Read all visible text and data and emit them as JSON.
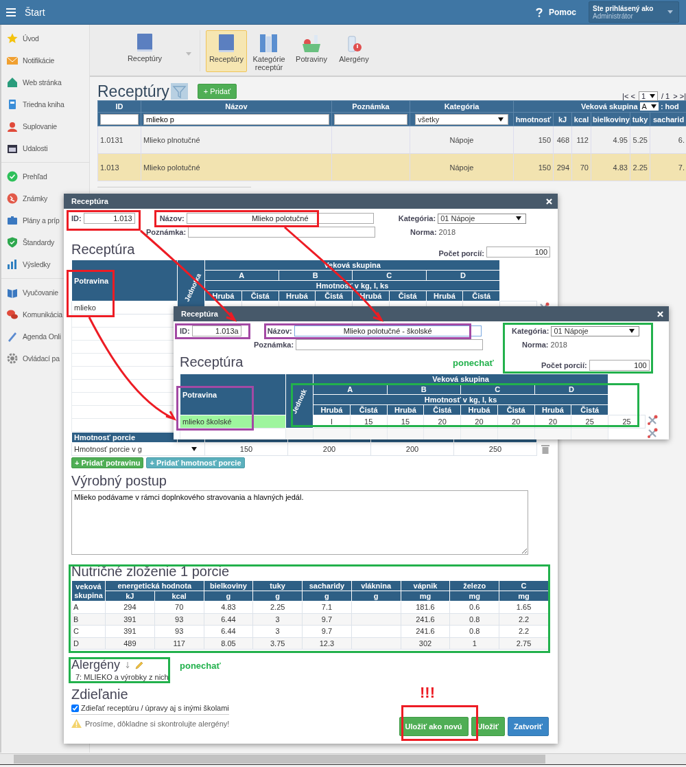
{
  "topbar": {
    "title": "Štart",
    "help": "Pomoc",
    "user_label": "Ste prihlásený ako",
    "user_name": "Administrátor"
  },
  "sidebar": {
    "groups": [
      {
        "items": [
          {
            "label": "Úvod"
          },
          {
            "label": "Notifikácie"
          },
          {
            "label": "Web stránka"
          },
          {
            "label": "Triedna kniha"
          },
          {
            "label": "Suplovanie"
          },
          {
            "label": "Udalosti"
          }
        ]
      },
      {
        "items": [
          {
            "label": "Prehľad"
          },
          {
            "label": "Známky"
          },
          {
            "label": "Plány a príp"
          },
          {
            "label": "Štandardy"
          },
          {
            "label": "Výsledky"
          }
        ]
      },
      {
        "items": [
          {
            "label": "Vyučovanie"
          },
          {
            "label": "Komunikácia"
          },
          {
            "label": "Agenda Onli"
          },
          {
            "label": "Ovládací pa"
          }
        ]
      }
    ]
  },
  "toolbar": {
    "menu": "Receptúry",
    "buttons": [
      {
        "label": "Receptúry",
        "selected": true
      },
      {
        "label": "Kategórie receptúr",
        "selected": false
      },
      {
        "label": "Potraviny",
        "selected": false
      },
      {
        "label": "Alergény",
        "selected": false
      }
    ]
  },
  "list": {
    "title": "Receptúry",
    "add_button": "+ Pridať",
    "pager": {
      "back": "|< <",
      "page": "1",
      "of": "/ 1",
      "forward": "> >|"
    },
    "columns": [
      "ID",
      "Názov",
      "Poznámka",
      "Kategória"
    ],
    "group_heading": "Veková skupina",
    "group_select": "A",
    "group_suffix": ": hod",
    "filters": {
      "name": "mlieko p",
      "category": "všetky"
    },
    "subcolumns": [
      "hmotnosť",
      "kJ",
      "kcal",
      "bielkoviny",
      "tuky",
      "sacharid"
    ],
    "rows": [
      {
        "id": "1.0131",
        "name": "Mlieko plnotučné",
        "category": "Nápoje",
        "values": [
          "150",
          "468",
          "112",
          "4.95",
          "5.25",
          "6."
        ],
        "selected": false
      },
      {
        "id": "1.013",
        "name": "Mlieko polotučné",
        "category": "Nápoje",
        "values": [
          "150",
          "294",
          "70",
          "4.83",
          "2.25",
          "7."
        ],
        "selected": true
      }
    ]
  },
  "dialog": {
    "title": "Receptúra",
    "id_label": "ID:",
    "id": "1.013",
    "name_label": "Názov:",
    "name": "Mlieko polotučné",
    "note_label": "Poznámka:",
    "category_label": "Kategória:",
    "category": "01 Nápoje",
    "norm_label": "Norma:",
    "norm": "2018",
    "section": "Receptúra",
    "portions_label": "Počet porcií:",
    "portions": "100",
    "table": {
      "food_header": "Potravina",
      "unit_header": "Jednotka",
      "group_header": "Veková skupina",
      "groups": [
        "A",
        "B",
        "C",
        "D"
      ],
      "weight_header": "Hmotnosť v kg, l, ks",
      "sub": [
        "Hrubá",
        "Čistá",
        "Hrubá",
        "Čistá",
        "Hrubá",
        "Čistá",
        "Hrubá",
        "Čistá"
      ],
      "rows": [
        {
          "food": "mlieko",
          "highlighted": false
        }
      ]
    },
    "portion_header": "Hmotnosť porcie",
    "portion_select": "Hmotnosť porcie v g",
    "portion_values": [
      "150",
      "200",
      "200",
      "250"
    ],
    "add_food": "+ Pridať potravinu",
    "add_portion": "+ Pridať hmotnosť porcie",
    "process_title": "Výrobný postup",
    "process_text": "Mlieko podávame v rámci doplnkového stravovania a hlavných jedál.",
    "nutrition": {
      "title": "Nutričné zloženie 1 porcie",
      "group_header": "veková skupina",
      "energy_header": "energetická hodnota",
      "headers": [
        "bielkoviny",
        "tuky",
        "sacharidy",
        "vláknina",
        "vápnik",
        "železo",
        "C"
      ],
      "units": [
        "kJ",
        "kcal",
        "g",
        "g",
        "g",
        "g",
        "mg",
        "mg",
        "mg"
      ],
      "rows": [
        {
          "group": "A",
          "values": [
            "294",
            "70",
            "4.83",
            "2.25",
            "7.1"
          ],
          "minerals": [
            "181.6",
            "0.6",
            "1.65"
          ]
        },
        {
          "group": "B",
          "values": [
            "391",
            "93",
            "6.44",
            "3",
            "9.7"
          ],
          "minerals": [
            "241.6",
            "0.8",
            "2.2"
          ]
        },
        {
          "group": "C",
          "values": [
            "391",
            "93",
            "6.44",
            "3",
            "9.7"
          ],
          "minerals": [
            "241.6",
            "0.8",
            "2.2"
          ]
        },
        {
          "group": "D",
          "values": [
            "489",
            "117",
            "8.05",
            "3.75",
            "12.3"
          ],
          "minerals": [
            "302",
            "1",
            "2.75"
          ]
        }
      ]
    },
    "allergens_title": "Alergény",
    "allergens": [
      "7: MLIEKO a výrobky z nich"
    ],
    "sharing_title": "Zdieľanie",
    "share": {
      "label": "Zdieľať receptúru / úpravy aj s inými školami",
      "checked": true
    },
    "warning": "Prosíme, dôkladne si skontrolujte alergény!",
    "buttons": [
      {
        "label": "Uložiť ako novú",
        "kind": "success"
      },
      {
        "label": "Uložiť",
        "kind": "success"
      },
      {
        "label": "Zatvoriť",
        "kind": "primary"
      }
    ]
  },
  "copy_dialog": {
    "title": "Receptúra",
    "id_label": "ID:",
    "id": "1.013a",
    "name_label": "Názov:",
    "name": "Mlieko polotučné - školské",
    "note_label": "Poznámka:",
    "category_label": "Kategória:",
    "category": "01 Nápoje",
    "norm_label": "Norma:",
    "norm": "2018",
    "section": "Receptúra",
    "portions_label": "Počet porcií:",
    "portions": "100",
    "table": {
      "food_header": "Potravina",
      "unit_header": "Jednotk",
      "group_header": "Veková skupina",
      "groups": [
        "A",
        "B",
        "C",
        "D"
      ],
      "weight_header": "Hmotnosť v kg, l, ks",
      "sub": [
        "Hrubá",
        "Čistá",
        "Hrubá",
        "Čistá",
        "Hrubá",
        "Čistá",
        "Hrubá",
        "Čistá"
      ],
      "rows": [
        {
          "food": "mlieko školské",
          "unit": "l",
          "values": [
            "15",
            "15",
            "20",
            "20",
            "20",
            "20",
            "25",
            "25"
          ],
          "highlighted": true
        }
      ]
    }
  },
  "annotations": {
    "frames": [
      {
        "color": "#ed1c24"
      },
      {
        "color": "#ed1c24"
      },
      {
        "color": "#ed1c24"
      },
      {
        "color": "#a349a4"
      },
      {
        "color": "#a349a4"
      },
      {
        "color": "#a349a4"
      },
      {
        "color": "#22b14c"
      },
      {
        "color": "#22b14c"
      },
      {
        "color": "#22b14c"
      },
      {
        "color": "#22b14c"
      },
      {
        "color": "#ed1c24"
      }
    ],
    "arrows": [
      {
        "color": "#ed1c24"
      },
      {
        "color": "#ed1c24"
      },
      {
        "color": "#ed1c24"
      }
    ],
    "notes": [
      {
        "text": "ponechať",
        "color": "#22b14c"
      },
      {
        "text": "ponechať",
        "color": "#22b14c"
      },
      {
        "text": "!!!",
        "color": "#ed1c24"
      }
    ]
  }
}
